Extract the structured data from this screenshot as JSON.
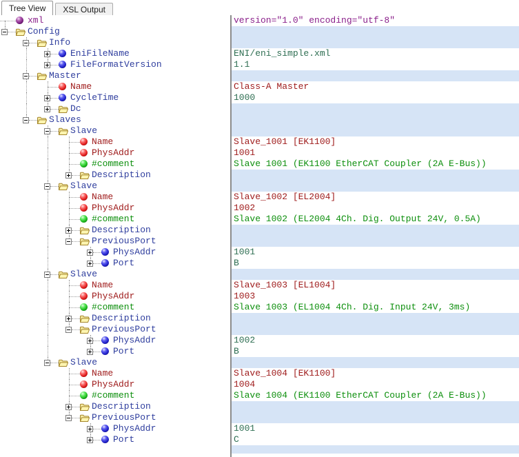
{
  "window": {
    "tabs": [
      {
        "label": "Tree View",
        "active": true
      },
      {
        "label": "XSL Output",
        "active": false
      }
    ]
  },
  "palette": {
    "container_row_bg": "#D6E4F6",
    "divider": "#8C8C8C",
    "tree_line": "#9A9A9A",
    "element_label": "#2F3E9E",
    "attribute_label": "#9E1A1A",
    "comment_text": "#0D8F0D",
    "xml_declaration_text": "#8A1F8A",
    "element_value_text": "#2E6E52"
  },
  "icon_legend": {
    "folder": "container-element-folder-icon",
    "orb-blue": "element-node-icon",
    "orb-red": "attribute-node-icon",
    "orb-green": "comment-node-icon",
    "orb-purple": "xml-declaration-icon"
  },
  "tree": {
    "rows": [
      {
        "name": "xml",
        "icon": "orb-purple",
        "level": 0,
        "box": null,
        "conn": "D",
        "guides": [],
        "ncls": "xml",
        "value": "version=\"1.0\" encoding=\"utf-8\"",
        "vcls": "xml",
        "bg": "plain"
      },
      {
        "name": "Config",
        "icon": "folder",
        "level": 0,
        "box": "minus",
        "conn": "L",
        "guides": [],
        "ncls": "el",
        "value": "",
        "vcls": "",
        "bg": "alt"
      },
      {
        "name": "Info",
        "icon": "folder",
        "level": 1,
        "box": "minus",
        "conn": "T",
        "guides": [],
        "ncls": "el",
        "value": "",
        "vcls": "",
        "bg": "alt"
      },
      {
        "name": "EniFileName",
        "icon": "orb-blue",
        "level": 2,
        "box": "plus",
        "conn": "T",
        "guides": [
          1
        ],
        "ncls": "el",
        "value": "ENI/eni_simple.xml",
        "vcls": "text",
        "bg": "plain"
      },
      {
        "name": "FileFormatVersion",
        "icon": "orb-blue",
        "level": 2,
        "box": "plus",
        "conn": "L",
        "guides": [
          1
        ],
        "ncls": "el",
        "value": "1.1",
        "vcls": "text",
        "bg": "plain"
      },
      {
        "name": "Master",
        "icon": "folder",
        "level": 1,
        "box": "minus",
        "conn": "T",
        "guides": [],
        "ncls": "el",
        "value": "",
        "vcls": "",
        "bg": "alt"
      },
      {
        "name": "Name",
        "icon": "orb-red",
        "level": 2,
        "box": null,
        "conn": "T",
        "guides": [
          1
        ],
        "ncls": "attr",
        "value": "Class-A Master",
        "vcls": "attr",
        "bg": "plain"
      },
      {
        "name": "CycleTime",
        "icon": "orb-blue",
        "level": 2,
        "box": "plus",
        "conn": "T",
        "guides": [
          1
        ],
        "ncls": "el",
        "value": "1000",
        "vcls": "text",
        "bg": "plain"
      },
      {
        "name": "Dc",
        "icon": "folder",
        "level": 2,
        "box": "plus",
        "conn": "L",
        "guides": [
          1
        ],
        "ncls": "el",
        "value": "",
        "vcls": "",
        "bg": "alt"
      },
      {
        "name": "Slaves",
        "icon": "folder",
        "level": 1,
        "box": "minus",
        "conn": "L",
        "guides": [],
        "ncls": "el",
        "value": "",
        "vcls": "",
        "bg": "alt"
      },
      {
        "name": "Slave",
        "icon": "folder",
        "level": 2,
        "box": "minus",
        "conn": "T",
        "guides": [],
        "ncls": "el",
        "value": "",
        "vcls": "",
        "bg": "alt"
      },
      {
        "name": "Name",
        "icon": "orb-red",
        "level": 3,
        "box": null,
        "conn": "T",
        "guides": [
          2
        ],
        "ncls": "attr",
        "value": "Slave_1001 [EK1100]",
        "vcls": "attr",
        "bg": "plain"
      },
      {
        "name": "PhysAddr",
        "icon": "orb-red",
        "level": 3,
        "box": null,
        "conn": "T",
        "guides": [
          2
        ],
        "ncls": "attr",
        "value": "1001",
        "vcls": "attr",
        "bg": "plain"
      },
      {
        "name": "#comment",
        "icon": "orb-green",
        "level": 3,
        "box": null,
        "conn": "T",
        "guides": [
          2
        ],
        "ncls": "cmt",
        "value": "Slave 1001 (EK1100 EtherCAT Coupler (2A E-Bus))",
        "vcls": "cmt",
        "bg": "plain"
      },
      {
        "name": "Description",
        "icon": "folder",
        "level": 3,
        "box": "plus",
        "conn": "L",
        "guides": [
          2
        ],
        "ncls": "el",
        "value": "",
        "vcls": "",
        "bg": "alt"
      },
      {
        "name": "Slave",
        "icon": "folder",
        "level": 2,
        "box": "minus",
        "conn": "T",
        "guides": [],
        "ncls": "el",
        "value": "",
        "vcls": "",
        "bg": "alt"
      },
      {
        "name": "Name",
        "icon": "orb-red",
        "level": 3,
        "box": null,
        "conn": "T",
        "guides": [
          2
        ],
        "ncls": "attr",
        "value": "Slave_1002 [EL2004]",
        "vcls": "attr",
        "bg": "plain"
      },
      {
        "name": "PhysAddr",
        "icon": "orb-red",
        "level": 3,
        "box": null,
        "conn": "T",
        "guides": [
          2
        ],
        "ncls": "attr",
        "value": "1002",
        "vcls": "attr",
        "bg": "plain"
      },
      {
        "name": "#comment",
        "icon": "orb-green",
        "level": 3,
        "box": null,
        "conn": "T",
        "guides": [
          2
        ],
        "ncls": "cmt",
        "value": "Slave 1002 (EL2004 4Ch. Dig. Output 24V, 0.5A)",
        "vcls": "cmt",
        "bg": "plain"
      },
      {
        "name": "Description",
        "icon": "folder",
        "level": 3,
        "box": "plus",
        "conn": "T",
        "guides": [
          2
        ],
        "ncls": "el",
        "value": "",
        "vcls": "",
        "bg": "alt"
      },
      {
        "name": "PreviousPort",
        "icon": "folder",
        "level": 3,
        "box": "minus",
        "conn": "L",
        "guides": [
          2
        ],
        "ncls": "el",
        "value": "",
        "vcls": "",
        "bg": "alt"
      },
      {
        "name": "PhysAddr",
        "icon": "orb-blue",
        "level": 4,
        "box": "plus",
        "conn": "T",
        "guides": [
          2
        ],
        "ncls": "el",
        "value": "1001",
        "vcls": "text",
        "bg": "plain"
      },
      {
        "name": "Port",
        "icon": "orb-blue",
        "level": 4,
        "box": "plus",
        "conn": "L",
        "guides": [
          2
        ],
        "ncls": "el",
        "value": "B",
        "vcls": "text",
        "bg": "plain"
      },
      {
        "name": "Slave",
        "icon": "folder",
        "level": 2,
        "box": "minus",
        "conn": "T",
        "guides": [],
        "ncls": "el",
        "value": "",
        "vcls": "",
        "bg": "alt"
      },
      {
        "name": "Name",
        "icon": "orb-red",
        "level": 3,
        "box": null,
        "conn": "T",
        "guides": [
          2
        ],
        "ncls": "attr",
        "value": "Slave_1003 [EL1004]",
        "vcls": "attr",
        "bg": "plain"
      },
      {
        "name": "PhysAddr",
        "icon": "orb-red",
        "level": 3,
        "box": null,
        "conn": "T",
        "guides": [
          2
        ],
        "ncls": "attr",
        "value": "1003",
        "vcls": "attr",
        "bg": "plain"
      },
      {
        "name": "#comment",
        "icon": "orb-green",
        "level": 3,
        "box": null,
        "conn": "T",
        "guides": [
          2
        ],
        "ncls": "cmt",
        "value": "Slave 1003 (EL1004 4Ch. Dig. Input 24V, 3ms)",
        "vcls": "cmt",
        "bg": "plain"
      },
      {
        "name": "Description",
        "icon": "folder",
        "level": 3,
        "box": "plus",
        "conn": "T",
        "guides": [
          2
        ],
        "ncls": "el",
        "value": "",
        "vcls": "",
        "bg": "alt"
      },
      {
        "name": "PreviousPort",
        "icon": "folder",
        "level": 3,
        "box": "minus",
        "conn": "L",
        "guides": [
          2
        ],
        "ncls": "el",
        "value": "",
        "vcls": "",
        "bg": "alt"
      },
      {
        "name": "PhysAddr",
        "icon": "orb-blue",
        "level": 4,
        "box": "plus",
        "conn": "T",
        "guides": [
          2
        ],
        "ncls": "el",
        "value": "1002",
        "vcls": "text",
        "bg": "plain"
      },
      {
        "name": "Port",
        "icon": "orb-blue",
        "level": 4,
        "box": "plus",
        "conn": "L",
        "guides": [
          2
        ],
        "ncls": "el",
        "value": "B",
        "vcls": "text",
        "bg": "plain"
      },
      {
        "name": "Slave",
        "icon": "folder",
        "level": 2,
        "box": "minus",
        "conn": "L",
        "guides": [],
        "ncls": "el",
        "value": "",
        "vcls": "",
        "bg": "alt"
      },
      {
        "name": "Name",
        "icon": "orb-red",
        "level": 3,
        "box": null,
        "conn": "T",
        "guides": [],
        "ncls": "attr",
        "value": "Slave_1004 [EK1100]",
        "vcls": "attr",
        "bg": "plain"
      },
      {
        "name": "PhysAddr",
        "icon": "orb-red",
        "level": 3,
        "box": null,
        "conn": "T",
        "guides": [],
        "ncls": "attr",
        "value": "1004",
        "vcls": "attr",
        "bg": "plain"
      },
      {
        "name": "#comment",
        "icon": "orb-green",
        "level": 3,
        "box": null,
        "conn": "T",
        "guides": [],
        "ncls": "cmt",
        "value": "Slave 1004 (EK1100 EtherCAT Coupler (2A E-Bus))",
        "vcls": "cmt",
        "bg": "plain"
      },
      {
        "name": "Description",
        "icon": "folder",
        "level": 3,
        "box": "plus",
        "conn": "T",
        "guides": [],
        "ncls": "el",
        "value": "",
        "vcls": "",
        "bg": "alt"
      },
      {
        "name": "PreviousPort",
        "icon": "folder",
        "level": 3,
        "box": "minus",
        "conn": "L",
        "guides": [],
        "ncls": "el",
        "value": "",
        "vcls": "",
        "bg": "alt"
      },
      {
        "name": "PhysAddr",
        "icon": "orb-blue",
        "level": 4,
        "box": "plus",
        "conn": "T",
        "guides": [],
        "ncls": "el",
        "value": "1001",
        "vcls": "text",
        "bg": "plain"
      },
      {
        "name": "Port",
        "icon": "orb-blue",
        "level": 4,
        "box": "plus",
        "conn": "L",
        "guides": [],
        "ncls": "el",
        "value": "C",
        "vcls": "text",
        "bg": "plain"
      }
    ]
  }
}
